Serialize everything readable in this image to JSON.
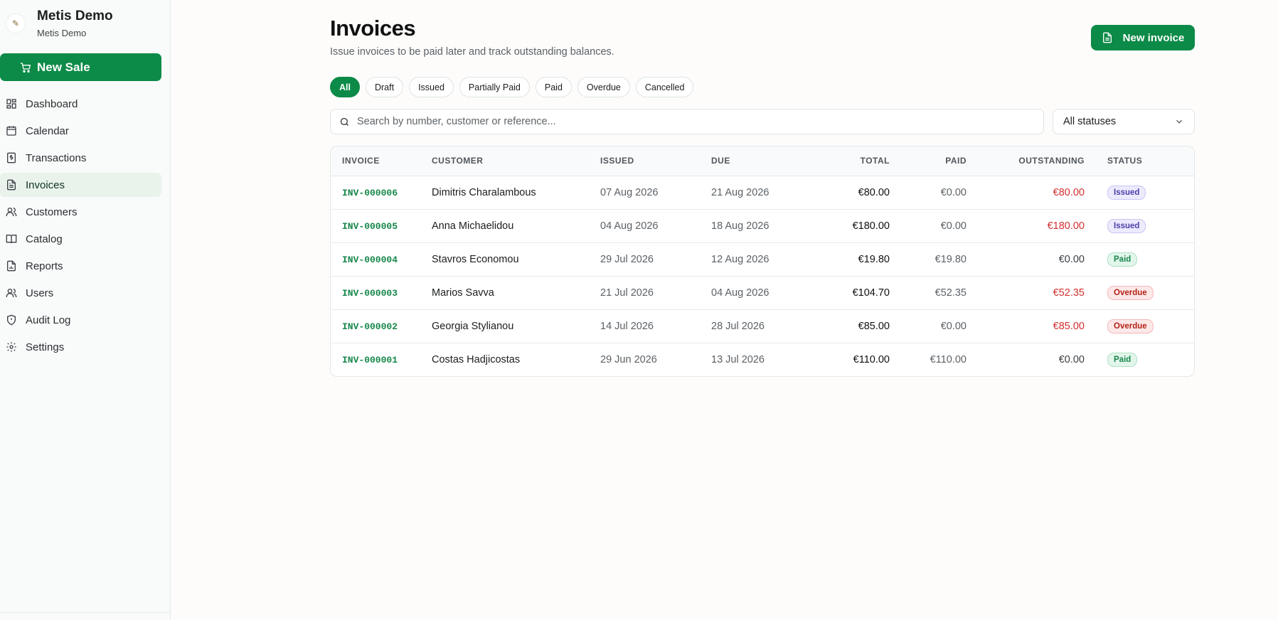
{
  "brand": {
    "name": "Metis Demo",
    "sub": "Metis Demo"
  },
  "new_sale_label": "New Sale",
  "nav": [
    {
      "label": "Dashboard",
      "icon": "dashboard-icon"
    },
    {
      "label": "Calendar",
      "icon": "calendar-icon"
    },
    {
      "label": "Transactions",
      "icon": "transactions-icon"
    },
    {
      "label": "Invoices",
      "icon": "invoice-icon",
      "active": true
    },
    {
      "label": "Customers",
      "icon": "customers-icon"
    },
    {
      "label": "Catalog",
      "icon": "catalog-icon"
    },
    {
      "label": "Reports",
      "icon": "reports-icon"
    },
    {
      "label": "Users",
      "icon": "users-icon"
    },
    {
      "label": "Audit Log",
      "icon": "shield-icon"
    },
    {
      "label": "Settings",
      "icon": "gear-icon"
    }
  ],
  "page": {
    "title": "Invoices",
    "subtitle": "Issue invoices to be paid later and track outstanding balances.",
    "new_invoice_label": "New invoice"
  },
  "tabs": [
    "All",
    "Draft",
    "Issued",
    "Partially Paid",
    "Paid",
    "Overdue",
    "Cancelled"
  ],
  "search": {
    "placeholder": "Search by number, customer or reference...",
    "value": ""
  },
  "status_filter": {
    "selected": "All statuses"
  },
  "table": {
    "headers": [
      "INVOICE",
      "CUSTOMER",
      "ISSUED",
      "DUE",
      "TOTAL",
      "PAID",
      "OUTSTANDING",
      "STATUS"
    ],
    "rows": [
      {
        "invoice": "INV-000006",
        "customer": "Dimitris Charalambous",
        "issued": "07 Aug 2026",
        "due": "21 Aug 2026",
        "total": "€80.00",
        "paid": "€0.00",
        "outstanding": "€80.00",
        "status": "Issued"
      },
      {
        "invoice": "INV-000005",
        "customer": "Anna Michaelidou",
        "issued": "04 Aug 2026",
        "due": "18 Aug 2026",
        "total": "€180.00",
        "paid": "€0.00",
        "outstanding": "€180.00",
        "status": "Issued"
      },
      {
        "invoice": "INV-000004",
        "customer": "Stavros Economou",
        "issued": "29 Jul 2026",
        "due": "12 Aug 2026",
        "total": "€19.80",
        "paid": "€19.80",
        "outstanding": "€0.00",
        "status": "Paid"
      },
      {
        "invoice": "INV-000003",
        "customer": "Marios Savva",
        "issued": "21 Jul 2026",
        "due": "04 Aug 2026",
        "total": "€104.70",
        "paid": "€52.35",
        "outstanding": "€52.35",
        "status": "Overdue"
      },
      {
        "invoice": "INV-000002",
        "customer": "Georgia Stylianou",
        "issued": "14 Jul 2026",
        "due": "28 Jul 2026",
        "total": "€85.00",
        "paid": "€0.00",
        "outstanding": "€85.00",
        "status": "Overdue"
      },
      {
        "invoice": "INV-000001",
        "customer": "Costas Hadjicostas",
        "issued": "29 Jun 2026",
        "due": "13 Jul 2026",
        "total": "€110.00",
        "paid": "€110.00",
        "outstanding": "€0.00",
        "status": "Paid"
      }
    ]
  },
  "colors": {
    "accent": "#0c8a47",
    "danger": "#d32f2f",
    "issued": "#4b3fa8"
  }
}
